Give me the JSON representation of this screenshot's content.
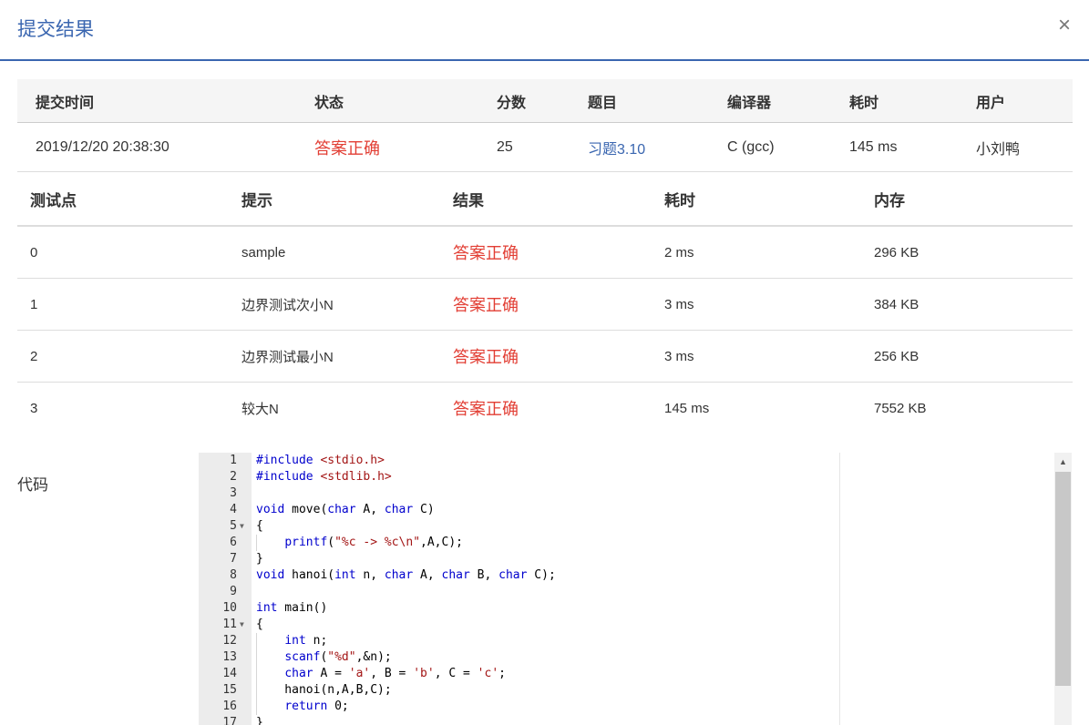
{
  "dialog": {
    "title": "提交结果",
    "close_label": "×"
  },
  "summary": {
    "headers": [
      "提交时间",
      "状态",
      "分数",
      "题目",
      "编译器",
      "耗时",
      "用户"
    ],
    "row": {
      "time": "2019/12/20 20:38:30",
      "status": "答案正确",
      "score": "25",
      "problem": "习题3.10",
      "compiler": "C (gcc)",
      "elapsed": "145 ms",
      "user": "小刘鸭"
    }
  },
  "cases": {
    "headers": [
      "测试点",
      "提示",
      "结果",
      "耗时",
      "内存"
    ],
    "rows": [
      {
        "id": "0",
        "hint": "sample",
        "result": "答案正确",
        "time": "2 ms",
        "memory": "296 KB"
      },
      {
        "id": "1",
        "hint": "边界测试次小N",
        "result": "答案正确",
        "time": "3 ms",
        "memory": "384 KB"
      },
      {
        "id": "2",
        "hint": "边界测试最小N",
        "result": "答案正确",
        "time": "3 ms",
        "memory": "256 KB"
      },
      {
        "id": "3",
        "hint": "较大N",
        "result": "答案正确",
        "time": "145 ms",
        "memory": "7552 KB"
      }
    ]
  },
  "code": {
    "label": "代码",
    "line_numbers": [
      "1",
      "2",
      "3",
      "4",
      "5",
      "6",
      "7",
      "8",
      "9",
      "10",
      "11",
      "12",
      "13",
      "14",
      "15",
      "16",
      "17"
    ],
    "lines": [
      "#include <stdio.h>",
      "#include <stdlib.h>",
      "",
      "void move(char A, char C)",
      "{",
      "    printf(\"%c -> %c\\n\",A,C);",
      "}",
      "void hanoi(int n, char A, char B, char C);",
      "",
      "int main()",
      "{",
      "    int n;",
      "    scanf(\"%d\",&n);",
      "    char A = 'a', B = 'b', C = 'c';",
      "    hanoi(n,A,B,C);",
      "    return 0;",
      "}"
    ]
  }
}
